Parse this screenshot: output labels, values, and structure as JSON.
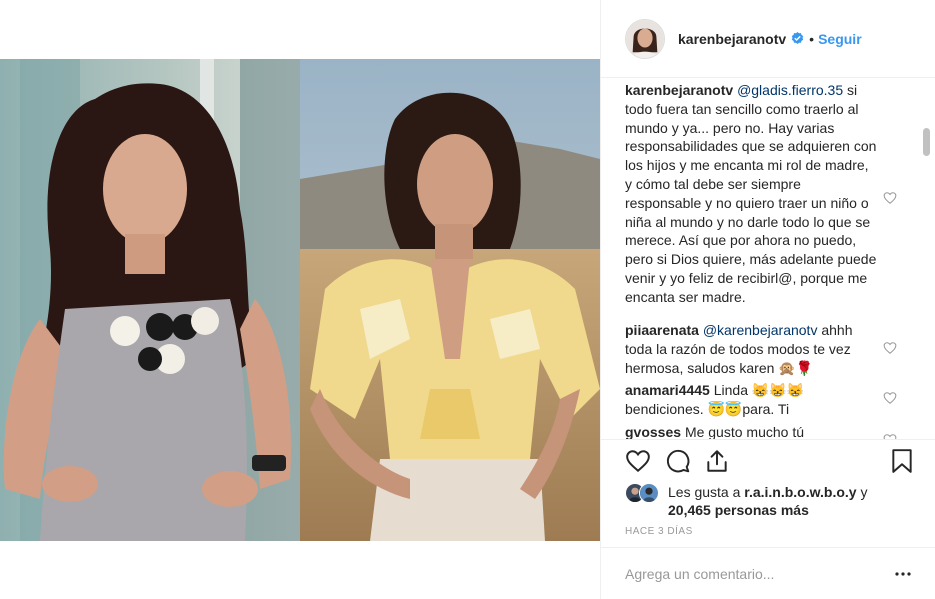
{
  "post": {
    "username": "karenbejaranotv",
    "follow_label": "Seguir",
    "dot": "•"
  },
  "comments": [
    {
      "username": "karenbejaranotv",
      "mention": "@gladis.fierro.35",
      "text": "si todo fuera tan sencillo como traerlo al mundo y ya... pero no. Hay varias responsabilidades que se adquieren con los hijos y me encanta mi rol de madre, y cómo tal debe ser siempre responsable y no quiero traer un niño o niña al mundo y no darle todo lo que se merece. Así que por ahora no puedo, pero si Dios quiere, más adelante puede venir y yo feliz de recibirl@, porque me encanta ser madre."
    },
    {
      "username": "piiaarenata",
      "mention": "@karenbejaranotv",
      "text": "ahhh toda la razón de todos modos te vez hermosa, saludos karen 🙊🌹"
    },
    {
      "username": "anamari4445",
      "mention": "",
      "text": "Linda 😸😸😸 bendiciones. 😇😇para. Ti"
    },
    {
      "username": "gvosses",
      "mention": "",
      "text": "Me gusto mucho tú"
    }
  ],
  "likes": {
    "prefix": "Les gusta a",
    "user": "r.a.i.n.b.o.w.b.o.y",
    "conj": "y",
    "count_text": "20,465 personas más"
  },
  "timestamp": "HACE 3 DÍAS",
  "add_comment": {
    "placeholder": "Agrega un comentario..."
  },
  "icons": {
    "verified": "verified-badge-icon",
    "like": "heart-icon",
    "comment": "comment-bubble-icon",
    "share": "share-icon",
    "save": "bookmark-icon",
    "more": "ellipsis-icon"
  },
  "colors": {
    "link_blue": "#3897f0",
    "mention_blue": "#003569",
    "text": "#262626",
    "muted": "#999999",
    "divider": "#efefef"
  }
}
